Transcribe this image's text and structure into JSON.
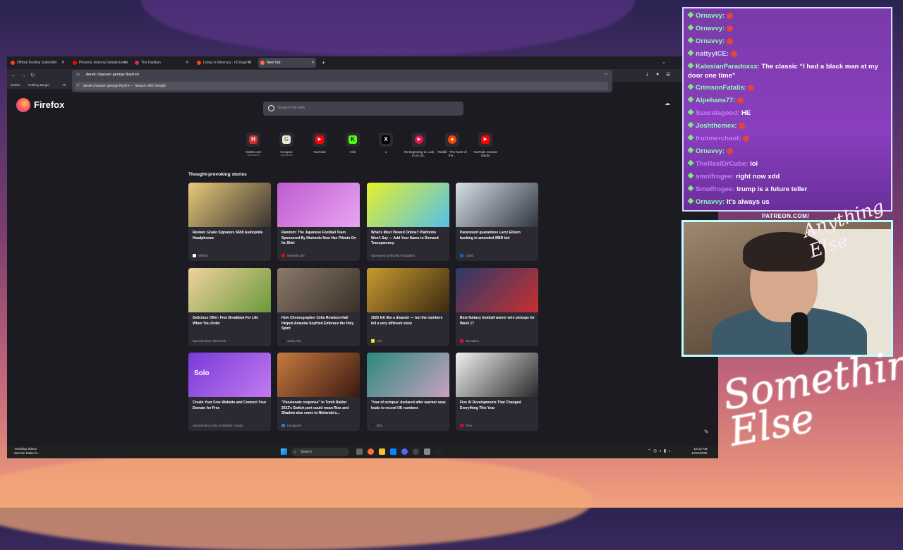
{
  "tabs": [
    {
      "label": "Official Destiny Subreddit",
      "favicon": "reddit-favicon",
      "color": "#ff4500"
    },
    {
      "label": "Phoenix, Arizona Debate Event",
      "favicon": "youtube-favicon",
      "color": "#ff0000"
    },
    {
      "label": "The Dailikan",
      "favicon": "site-favicon",
      "color": "#e0245e"
    },
    {
      "label": "Living in Idiocracy : r/CringeTik",
      "favicon": "reddit-favicon",
      "color": "#ff4500"
    },
    {
      "label": "New Tab",
      "favicon": "firefox-favicon",
      "color": "#ff7139"
    }
  ],
  "urlbar": {
    "value": "derek chauven george floyd kn",
    "suggestion": "derek chauven george floyd k — Search with Google"
  },
  "bookmarks": [
    "Dailies",
    "Nothing Burger",
    "TC"
  ],
  "brand": {
    "name": "Firefox"
  },
  "search": {
    "placeholder": "Search the web"
  },
  "shortcuts": [
    {
      "label": "Hotels.com",
      "sponsored": "Sponsored",
      "icon": "hotels-icon",
      "color": "#d32f2f"
    },
    {
      "label": "Groupon",
      "sponsored": "Sponsored",
      "icon": "groupon-icon",
      "color": "#e8e8e8"
    },
    {
      "label": "YouTube",
      "sponsored": "",
      "icon": "youtube-icon",
      "color": "#ff0000"
    },
    {
      "label": "Kick",
      "sponsored": "",
      "icon": "kick-icon",
      "color": "#53fc18"
    },
    {
      "label": "x",
      "sponsored": "",
      "icon": "x-icon",
      "color": "#000000"
    },
    {
      "label": "It's Beginning to Look a Lot Lik...",
      "sponsored": "",
      "icon": "circle-play-icon",
      "color": "#e8114a"
    },
    {
      "label": "Reddit - The heart of the...",
      "sponsored": "",
      "icon": "reddit-icon",
      "color": "#ff4500"
    },
    {
      "label": "YouTube Creator Studio",
      "sponsored": "",
      "icon": "youtube-studio-icon",
      "color": "#ff0000"
    }
  ],
  "stories_title": "Thought-provoking stories",
  "stories": [
    {
      "headline": "Review: Grado Signature S650 Audiophile Headphones",
      "source": "WIRED",
      "dot": "#ffffff",
      "img": [
        "#e9c97a",
        "#3a3530"
      ]
    },
    {
      "headline": "Random: The Japanese Football Team Sponsored By Nintendo Now Has Pikmin On Its Shirt",
      "source": "Nintendo Life",
      "dot": "#e60012",
      "img": [
        "#c05ad0",
        "#e6a6f0"
      ]
    },
    {
      "headline": "What's Most Viewed Online? Platforms Won't Say — Add Your Name to Demand Transparency.",
      "source": "Sponsored by Mozilla Foundation",
      "dot": "",
      "img": [
        "#e6f02c",
        "#55c0e8"
      ]
    },
    {
      "headline": "Paramount guarantees Larry Ellison backing in amended WBD bid",
      "source": "CNBC",
      "dot": "#1b5fb5",
      "img": [
        "#d8dee6",
        "#2e3640"
      ]
    },
    {
      "headline": "Delicious Offer: Free Breakfast For Life When You Order",
      "source": "Sponsored by HelloFresh",
      "dot": "",
      "img": [
        "#f0d2a0",
        "#6a9a3a"
      ]
    },
    {
      "headline": "How Choreographer Celia Rowlson-Hall Helped Amanda Seyfried Embrace the Holy Spirit",
      "source": "Vanity Fair",
      "dot": "#222222",
      "img": [
        "#8a7a6a",
        "#3a3028"
      ]
    },
    {
      "headline": "2025 felt like a disaster — but the numbers tell a very different story",
      "source": "Vox",
      "dot": "#f7e12b",
      "img": [
        "#c89a30",
        "#3a2a10"
      ]
    },
    {
      "headline": "Best fantasy football waiver wire pickups for Week 17",
      "source": "SB Nation",
      "dot": "#c8102e",
      "img": [
        "#2a3a6a",
        "#c83030"
      ]
    },
    {
      "headline": "Create Your Free Website and Connect Your Domain for Free",
      "source": "Sponsored by Solo AI Website Creator",
      "dot": "",
      "img": [
        "#7a3ad8",
        "#c07af0"
      ]
    },
    {
      "headline": "\"Passionate response\" to Tomb Raider 2013's Switch port could mean Rise and Shadow also come to Nintendo's...",
      "source": "Eurogamer",
      "dot": "#2a7ad8",
      "img": [
        "#c87a40",
        "#3a1a10"
      ]
    },
    {
      "headline": "'Year of octopus' declared after warmer seas leads to record UK numbers",
      "source": "BBC",
      "dot": "#222222",
      "img": [
        "#2a8a7a",
        "#c8a0c0"
      ]
    },
    {
      "headline": "Five AI Developments That Changed Everything This Year",
      "source": "Time",
      "dot": "#c8102e",
      "img": [
        "#f0f0f0",
        "#2a2a2a"
      ]
    }
  ],
  "solo_logo": "Solo",
  "taskbar": {
    "news_title": "Trending videos",
    "news_sub": "See the trailer fo...",
    "search_label": "Search",
    "time": "10:14 AM",
    "date": "12/22/2025"
  },
  "chat": [
    {
      "user": "Ornavvy:",
      "text": "",
      "user_color": "#8dffb0",
      "emote": true
    },
    {
      "user": "Ornavvy:",
      "text": "",
      "user_color": "#8dffb0",
      "emote": true
    },
    {
      "user": "Ornavvy:",
      "text": "",
      "user_color": "#8dffb0",
      "emote": true
    },
    {
      "user": "nattyyICE:",
      "text": "",
      "user_color": "#d7d7ff",
      "emote": true
    },
    {
      "user": "KalosianParadoxxx:",
      "text": "The classic “I had a black man at my door one time”",
      "user_color": "#8dffb0",
      "emote": false
    },
    {
      "user": "CrimsonFatalis:",
      "text": "",
      "user_color": "#8dffb0",
      "emote": true
    },
    {
      "user": "Alpehans77:",
      "text": "",
      "user_color": "#8dffb0",
      "emote": true
    },
    {
      "user": "Saucelagood:",
      "text": "HE",
      "user_color": "#c77dff",
      "emote": false
    },
    {
      "user": "Joshthemex:",
      "text": "",
      "user_color": "#8dffb0",
      "emote": true
    },
    {
      "user": "fruitmerchant:",
      "text": "",
      "user_color": "#c77dff",
      "emote": true
    },
    {
      "user": "Ornavvy:",
      "text": "",
      "user_color": "#8dffb0",
      "emote": true
    },
    {
      "user": "TheRealDrCube:",
      "text": "lol",
      "user_color": "#c77dff",
      "emote": false
    },
    {
      "user": "smolfrogee:",
      "text": "right now xdd",
      "user_color": "#c77dff",
      "emote": false
    },
    {
      "user": "Smolfrogee:",
      "text": "trump is a future teller",
      "user_color": "#c77dff",
      "emote": false
    },
    {
      "user": "Ornavvy:",
      "text": "It's always us",
      "user_color": "#8dffb0",
      "emote": false
    }
  ],
  "patreon": "PATREON.COM/",
  "signature": "Anything Else",
  "overlay_brand": "Something Else"
}
